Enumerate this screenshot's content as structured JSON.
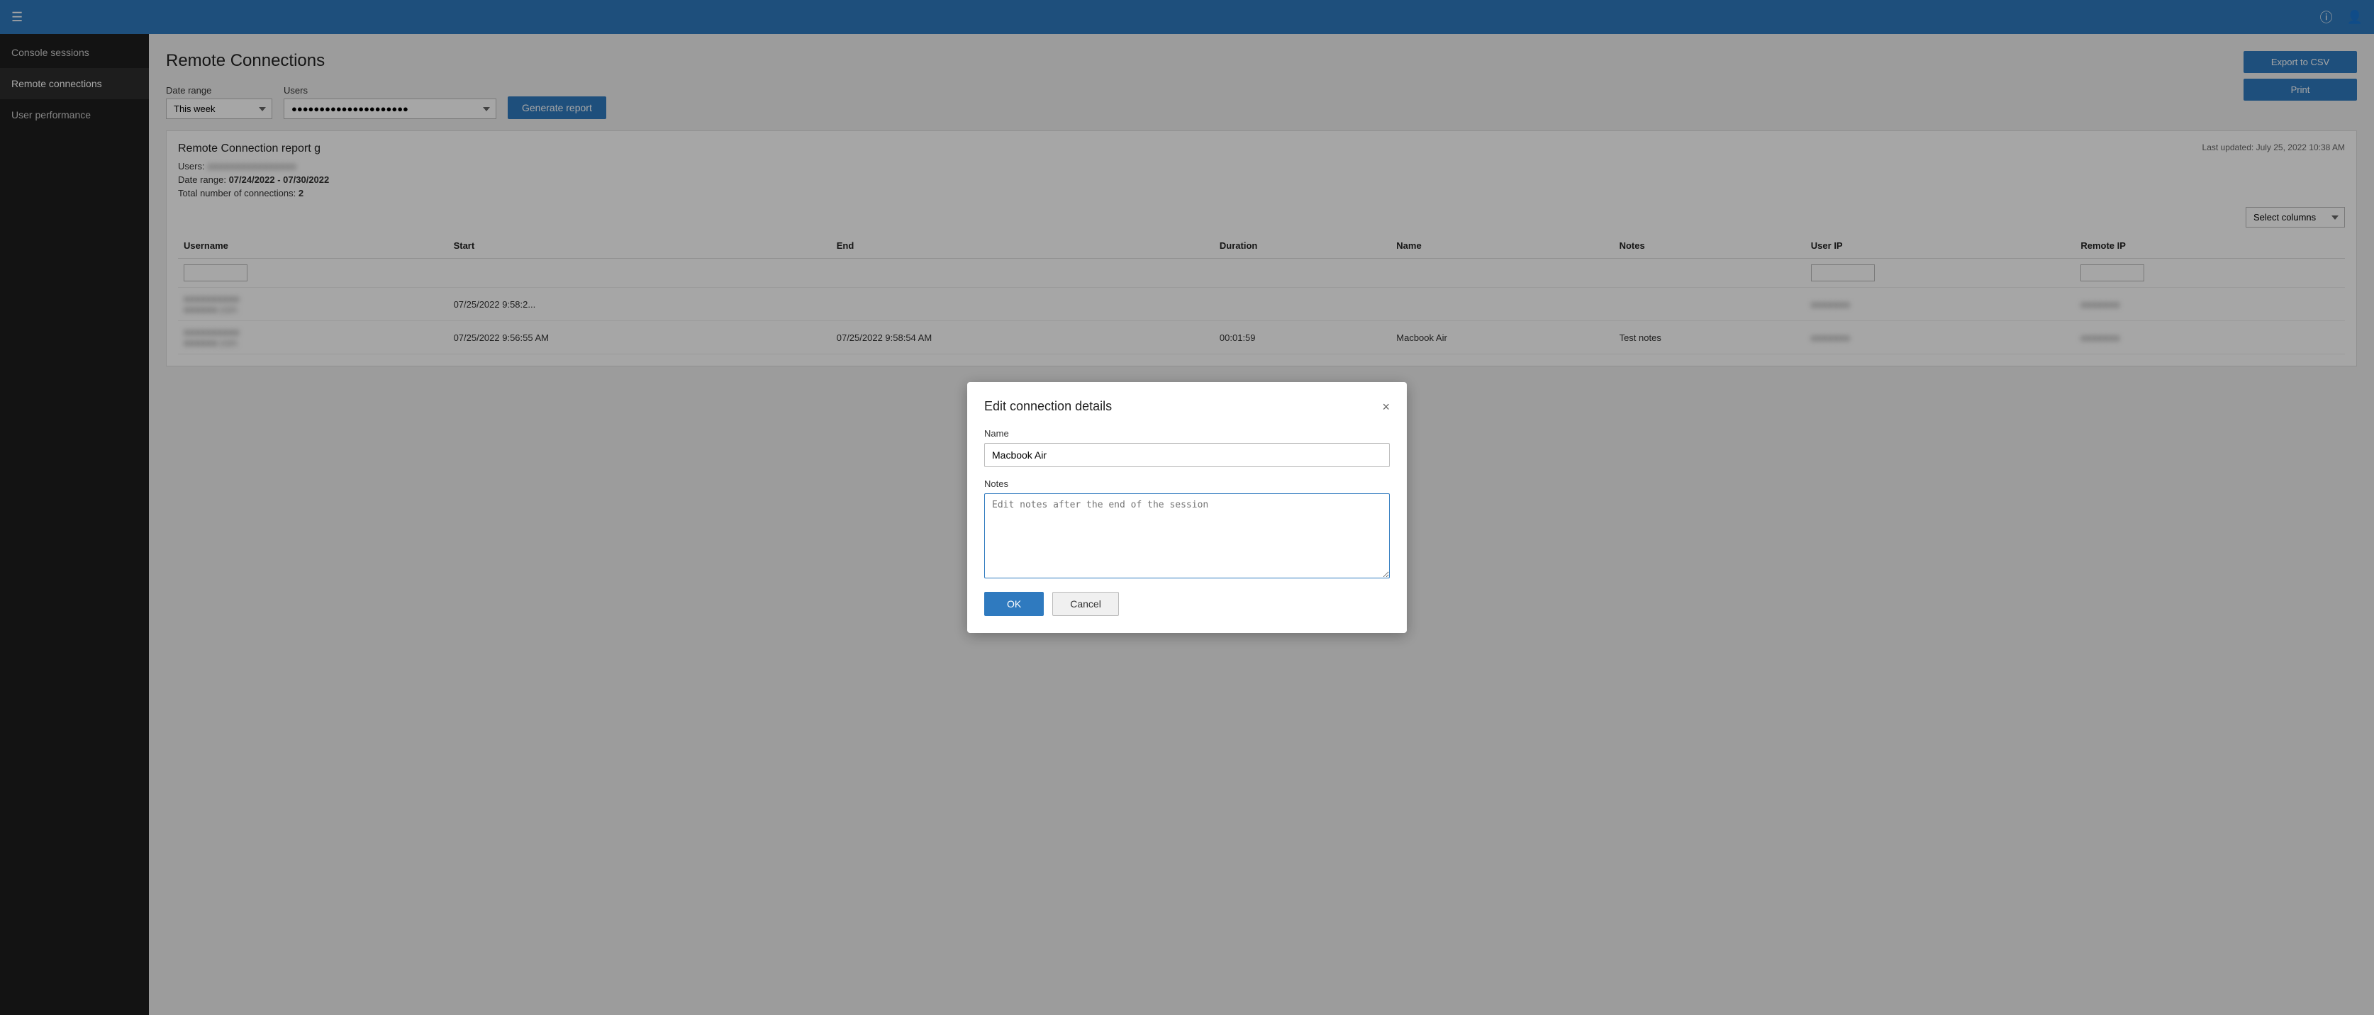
{
  "topbar": {
    "hamburger": "☰",
    "help_icon": "?",
    "user_icon": "👤"
  },
  "sidebar": {
    "items": [
      {
        "label": "Console sessions",
        "active": false
      },
      {
        "label": "Remote connections",
        "active": true
      },
      {
        "label": "User performance",
        "active": false
      }
    ]
  },
  "page": {
    "title": "Remote Connections",
    "date_range_label": "Date range",
    "date_range_value": "This week",
    "users_label": "Users",
    "users_placeholder": "●●●●●●●●●●●●●●●●●●●●●",
    "generate_button": "Generate report",
    "export_csv_button": "Export to CSV",
    "print_button": "Print"
  },
  "report": {
    "title": "Remote Connection report g",
    "users_label": "Users:",
    "users_value": "●●●●●●●●●●●●●●●●",
    "date_range_label": "Date range:",
    "date_range_value": "07/24/2022 - 07/30/2022",
    "total_label": "Total number of connections:",
    "total_value": "2",
    "last_updated": "Last updated: July 25, 2022 10:38 AM",
    "select_columns_placeholder": "Select columns"
  },
  "table": {
    "columns": [
      "Username",
      "Start",
      "End",
      "Duration",
      "Name",
      "Notes",
      "User IP",
      "Remote IP"
    ],
    "filter_row": [
      "",
      "",
      "",
      "",
      "",
      "",
      "",
      ""
    ],
    "rows": [
      {
        "username": "●●●●●●●●●●\n●●●●●●.com",
        "start": "07/25/2022 9:58:2...",
        "end": "",
        "duration": "",
        "name": "",
        "notes": "",
        "user_ip": "●●●●●●●",
        "remote_ip": "●●●●●●●"
      },
      {
        "username": "●●●●●●●●●●\n●●●●●●.com",
        "start": "07/25/2022 9:56:55 AM",
        "end": "07/25/2022 9:58:54 AM",
        "duration": "00:01:59",
        "name": "Macbook Air",
        "notes": "Test notes",
        "user_ip": "●●●●●●●",
        "remote_ip": "●●●●●●●"
      }
    ]
  },
  "modal": {
    "title": "Edit connection details",
    "close_label": "×",
    "name_label": "Name",
    "name_value": "Macbook Air",
    "notes_label": "Notes",
    "notes_placeholder": "Edit notes after the end of the session",
    "ok_button": "OK",
    "cancel_button": "Cancel"
  }
}
